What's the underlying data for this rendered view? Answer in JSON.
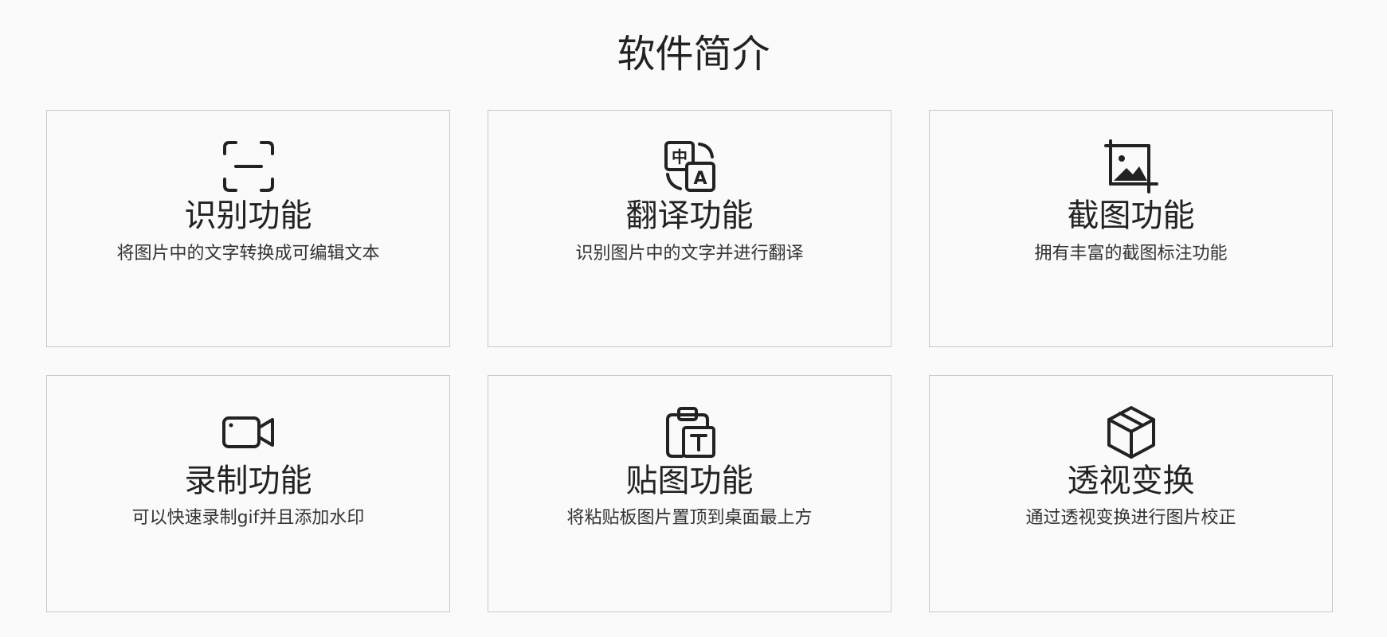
{
  "page": {
    "title": "软件简介"
  },
  "colors": {
    "background": "#fafafa",
    "border": "#c8c8c8",
    "text": "#222222"
  },
  "features": [
    {
      "icon": "scan-icon",
      "title": "识别功能",
      "desc": "将图片中的文字转换成可编辑文本"
    },
    {
      "icon": "translate-icon",
      "title": "翻译功能",
      "desc": "识别图片中的文字并进行翻译"
    },
    {
      "icon": "crop-image-icon",
      "title": "截图功能",
      "desc": "拥有丰富的截图标注功能"
    },
    {
      "icon": "video-camera-icon",
      "title": "录制功能",
      "desc": "可以快速录制gif并且添加水印"
    },
    {
      "icon": "clipboard-text-icon",
      "title": "贴图功能",
      "desc": "将粘贴板图片置顶到桌面最上方"
    },
    {
      "icon": "cube-icon",
      "title": "透视变换",
      "desc": "通过透视变换进行图片校正"
    }
  ]
}
